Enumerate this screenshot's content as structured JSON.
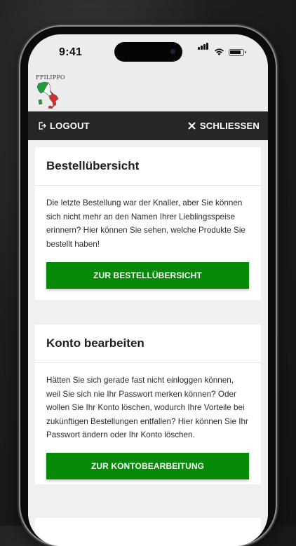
{
  "status_bar": {
    "time": "9:41"
  },
  "brand": {
    "name": "FFILIPPO",
    "flag_colors": [
      "#1f9d3a",
      "#ffffff",
      "#d32f2f"
    ]
  },
  "nav": {
    "logout_label": "LOGOUT",
    "close_label": "SCHLIESSEN"
  },
  "cards": [
    {
      "title": "Bestellübersicht",
      "text": "Die letzte Bestellung war der Knaller, aber Sie können sich nicht mehr an den Namen Ihrer Lieblingsspeise erinnern? Hier können Sie sehen, welche Produkte Sie bestellt haben!",
      "button": "ZUR BESTELLÜBERSICHT"
    },
    {
      "title": "Konto bearbeiten",
      "text": "Hätten Sie sich gerade fast nicht einloggen können, weil Sie sich nie Ihr Passwort merken können? Oder wollen Sie Ihr Konto löschen, wodurch Ihre Vorteile bei zukünftigen Bestellungen entfallen? Hier können Sie Ihr Passwort ändern oder Ihr Konto löschen.",
      "button": "ZUR KONTOBEARBEITUNG"
    }
  ],
  "colors": {
    "accent": "#078a07",
    "navbar": "#262626",
    "background": "#f0f0f0"
  }
}
